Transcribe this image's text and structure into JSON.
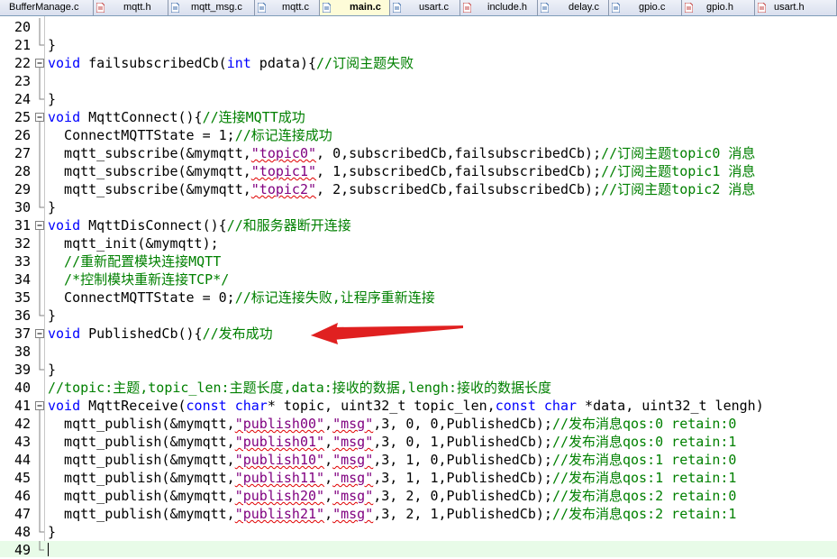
{
  "tabs": [
    {
      "label": "BufferManage.c",
      "active": false,
      "icon": "c-file-icon"
    },
    {
      "label": "mqtt.h",
      "active": false,
      "icon": "h-file-icon"
    },
    {
      "label": "mqtt_msg.c",
      "active": false,
      "icon": "c-file-icon"
    },
    {
      "label": "mqtt.c",
      "active": false,
      "icon": "c-file-icon"
    },
    {
      "label": "main.c",
      "active": true,
      "icon": "c-file-icon"
    },
    {
      "label": "usart.c",
      "active": false,
      "icon": "c-file-icon"
    },
    {
      "label": "include.h",
      "active": false,
      "icon": "h-file-icon"
    },
    {
      "label": "delay.c",
      "active": false,
      "icon": "c-file-icon"
    },
    {
      "label": "gpio.c",
      "active": false,
      "icon": "c-file-icon"
    },
    {
      "label": "gpio.h",
      "active": false,
      "icon": "h-file-icon"
    },
    {
      "label": "usart.h",
      "active": false,
      "icon": "h-file-icon"
    }
  ],
  "colors": {
    "keyword": "#0000ff",
    "comment": "#008000",
    "string": "#800080",
    "arrow": "#e02020",
    "active_tab": "#fefcd8"
  },
  "code": {
    "line_numbers": [
      "20",
      "21",
      "22",
      "23",
      "24",
      "25",
      "26",
      "27",
      "28",
      "29",
      "30",
      "31",
      "32",
      "33",
      "34",
      "35",
      "36",
      "37",
      "38",
      "39",
      "40",
      "41",
      "42",
      "43",
      "44",
      "45",
      "46",
      "47",
      "48",
      "49"
    ],
    "l20": "",
    "l21": "}",
    "l22": {
      "kw1": "void",
      "t1": " failsubscribedCb(",
      "kw2": "int",
      "t2": " pdata){",
      "cm": "//订阅主题失败"
    },
    "l23": "",
    "l24": "}",
    "l25": {
      "kw1": "void",
      "t1": " MqttConnect(){",
      "cm": "//连接MQTT成功"
    },
    "l26": {
      "t1": "  ConnectMQTTState = 1;",
      "cm": "//标记连接成功"
    },
    "l27": {
      "t1": "  mqtt_subscribe(&mymqtt,",
      "s1": "\"topic0\"",
      "t2": ", 0,subscribedCb,failsubscribedCb);",
      "cm": "//订阅主题topic0 消息"
    },
    "l28": {
      "t1": "  mqtt_subscribe(&mymqtt,",
      "s1": "\"topic1\"",
      "t2": ", 1,subscribedCb,failsubscribedCb);",
      "cm": "//订阅主题topic1 消息"
    },
    "l29": {
      "t1": "  mqtt_subscribe(&mymqtt,",
      "s1": "\"topic2\"",
      "t2": ", 2,subscribedCb,failsubscribedCb);",
      "cm": "//订阅主题topic2 消息"
    },
    "l30": "}",
    "l31": {
      "kw1": "void",
      "t1": " MqttDisConnect(){",
      "cm": "//和服务器断开连接"
    },
    "l32": "  mqtt_init(&mymqtt);",
    "l33": "  //重新配置模块连接MQTT",
    "l34": "  /*控制模块重新连接TCP*/",
    "l35": {
      "t1": "  ConnectMQTTState = 0;",
      "cm": "//标记连接失败,让程序重新连接"
    },
    "l36": "}",
    "l37": {
      "kw1": "void",
      "t1": " PublishedCb(){",
      "cm": "//发布成功"
    },
    "l38": "",
    "l39": "}",
    "l40": "//topic:主题,topic_len:主题长度,data:接收的数据,lengh:接收的数据长度",
    "l41": {
      "kw1": "void",
      "t1": " MqttReceive(",
      "kw2": "const",
      "t2": " ",
      "kw3": "char",
      "t3": "* topic, uint32_t topic_len,",
      "kw4": "const",
      "t4": " ",
      "kw5": "char",
      "t5": " *data, uint32_t lengh)"
    },
    "l42": {
      "t1": "  mqtt_publish(&mymqtt,",
      "s1": "\"publish00\"",
      "c1": ",",
      "s2": "\"msg\"",
      "t2": ",3, 0, 0,PublishedCb);",
      "cm": "//发布消息qos:0 retain:0"
    },
    "l43": {
      "t1": "  mqtt_publish(&mymqtt,",
      "s1": "\"publish01\"",
      "c1": ",",
      "s2": "\"msg\"",
      "t2": ",3, 0, 1,PublishedCb);",
      "cm": "//发布消息qos:0 retain:1"
    },
    "l44": {
      "t1": "  mqtt_publish(&mymqtt,",
      "s1": "\"publish10\"",
      "c1": ",",
      "s2": "\"msg\"",
      "t2": ",3, 1, 0,PublishedCb);",
      "cm": "//发布消息qos:1 retain:0"
    },
    "l45": {
      "t1": "  mqtt_publish(&mymqtt,",
      "s1": "\"publish11\"",
      "c1": ",",
      "s2": "\"msg\"",
      "t2": ",3, 1, 1,PublishedCb);",
      "cm": "//发布消息qos:1 retain:1"
    },
    "l46": {
      "t1": "  mqtt_publish(&mymqtt,",
      "s1": "\"publish20\"",
      "c1": ",",
      "s2": "\"msg\"",
      "t2": ",3, 2, 0,PublishedCb);",
      "cm": "//发布消息qos:2 retain:0"
    },
    "l47": {
      "t1": "  mqtt_publish(&mymqtt,",
      "s1": "\"publish21\"",
      "c1": ",",
      "s2": "\"msg\"",
      "t2": ",3, 2, 1,PublishedCb);",
      "cm": "//发布消息qos:2 retain:1"
    },
    "l48": "}",
    "l49": ""
  }
}
